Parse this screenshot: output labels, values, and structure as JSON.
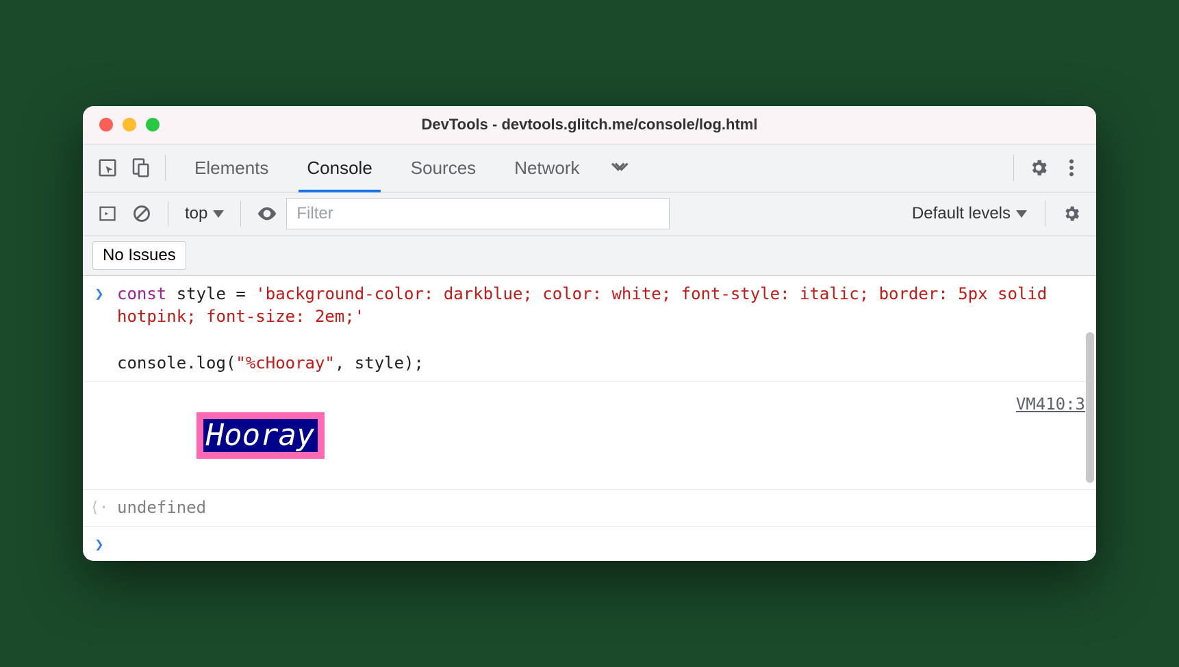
{
  "window": {
    "title": "DevTools - devtools.glitch.me/console/log.html"
  },
  "tabs": {
    "items": [
      "Elements",
      "Console",
      "Sources",
      "Network"
    ],
    "active": "Console"
  },
  "subbar": {
    "context": "top",
    "filter_placeholder": "Filter",
    "levels": "Default levels"
  },
  "issues": {
    "label": "No Issues"
  },
  "code": {
    "kw": "const",
    "id1": " style = ",
    "str": "'background-color: darkblue; color: white; font-style: italic; border: 5px solid hotpink; font-size: 2em;'",
    "line2a": "console.log(",
    "line2b": "\"%cHooray\"",
    "line2c": ", style);"
  },
  "output": {
    "text": "Hooray",
    "source": "VM410:3"
  },
  "return": {
    "value": "undefined"
  }
}
